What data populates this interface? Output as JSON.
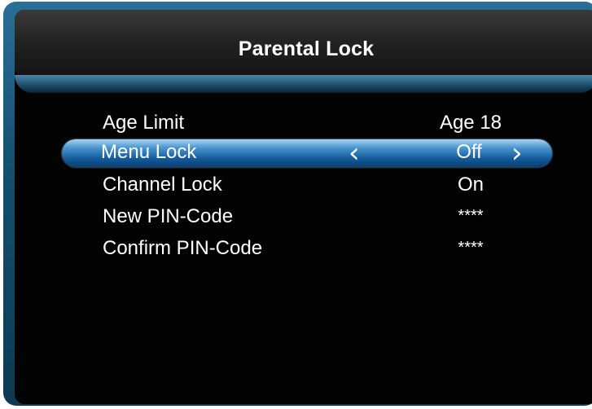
{
  "header": {
    "title": "Parental Lock"
  },
  "menu": {
    "items": [
      {
        "label": "Age Limit",
        "value": "Age 18",
        "selected": false
      },
      {
        "label": "Menu Lock",
        "value": "Off",
        "selected": true
      },
      {
        "label": "Channel Lock",
        "value": "On",
        "selected": false
      },
      {
        "label": "New PIN-Code",
        "value": "****",
        "selected": false
      },
      {
        "label": "Confirm PIN-Code",
        "value": "****",
        "selected": false
      }
    ],
    "arrow_left": "‹",
    "arrow_right": "›"
  },
  "colors": {
    "selection_bar": "#2a78b8",
    "frame": "#1a5a80",
    "background": "#030303",
    "text": "#ffffff"
  }
}
